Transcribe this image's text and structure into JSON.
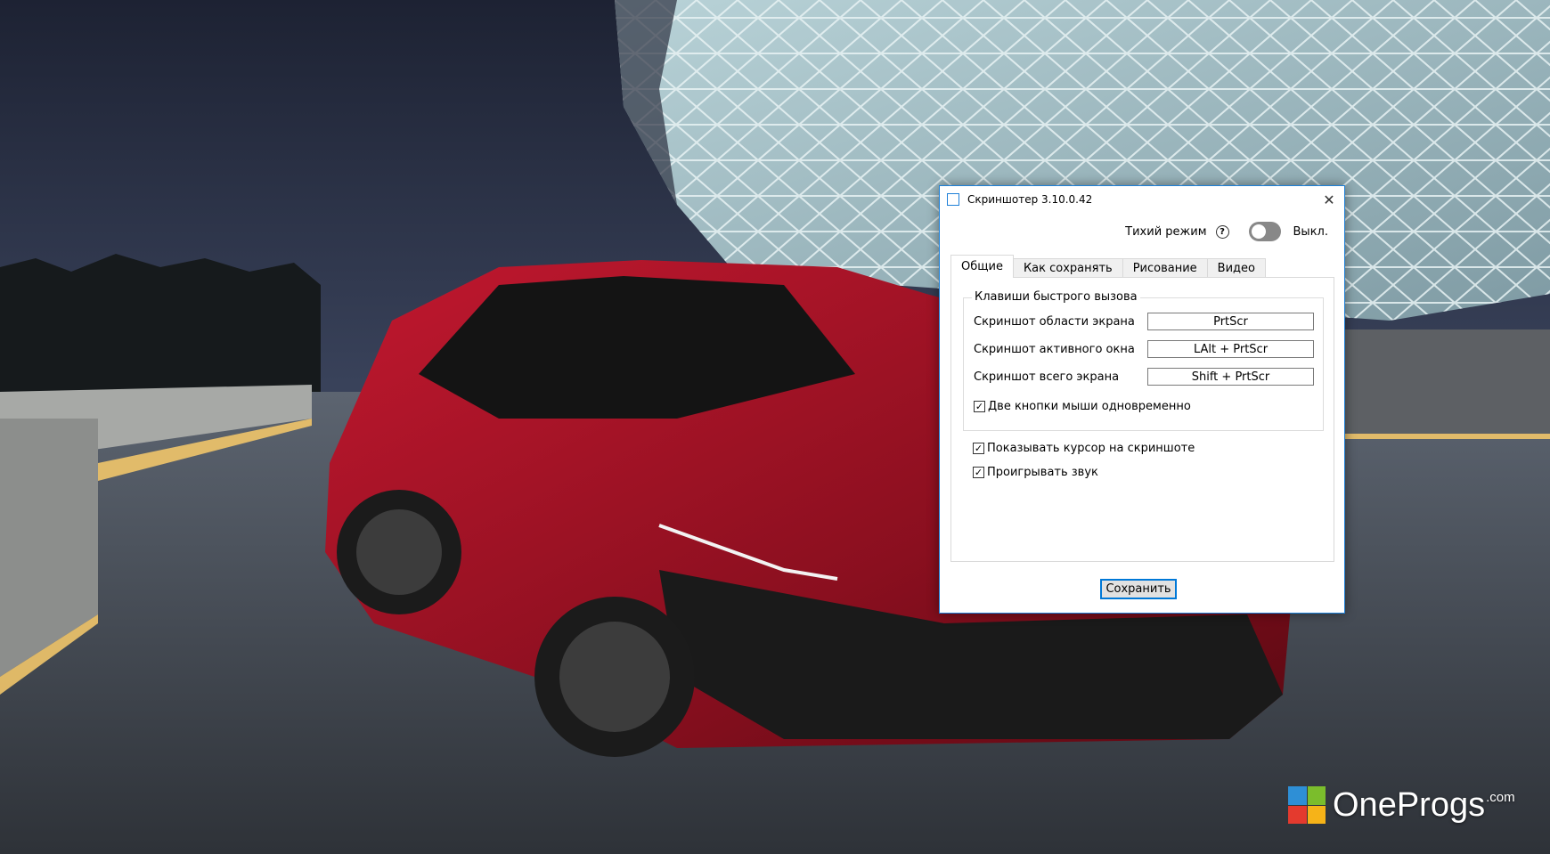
{
  "window": {
    "title": "Скриншотер 3.10.0.42",
    "close_glyph": "✕",
    "accent_color": "#1e80d8"
  },
  "quiet_mode": {
    "label": "Тихий режим",
    "help_glyph": "?",
    "state_text": "Выкл.",
    "enabled": false
  },
  "tabs": [
    {
      "label": "Общие",
      "active": true
    },
    {
      "label": "Как сохранять",
      "active": false
    },
    {
      "label": "Рисование",
      "active": false
    },
    {
      "label": "Видео",
      "active": false
    }
  ],
  "hotkeys": {
    "group_title": "Клавиши быстрого вызова",
    "rows": [
      {
        "label": "Скриншот области экрана",
        "value": "PrtScr"
      },
      {
        "label": "Скриншот активного окна",
        "value": "LAlt + PrtScr"
      },
      {
        "label": "Скриншот всего экрана",
        "value": "Shift + PrtScr"
      }
    ],
    "both_mouse_buttons": {
      "label": "Две кнопки мыши одновременно",
      "checked": true
    }
  },
  "options": [
    {
      "label": "Показывать курсор на скриншоте",
      "checked": true
    },
    {
      "label": "Проигрывать звук",
      "checked": true
    }
  ],
  "save_button": "Сохранить",
  "check_glyph": "✓",
  "watermark": {
    "name": "OneProgs",
    "suffix": ".com",
    "logo_colors": [
      "#2e8fd6",
      "#7bbd2c",
      "#e43a2e",
      "#f6b318"
    ]
  }
}
